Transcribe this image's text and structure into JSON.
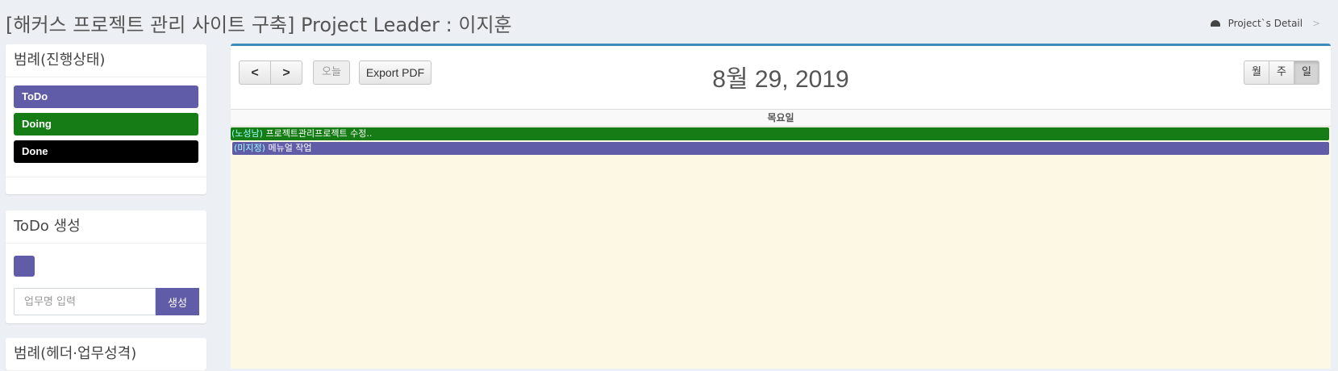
{
  "header": {
    "title": "[해커스 프로젝트 관리 사이트 구축] Project Leader : 이지훈",
    "breadcrumb": {
      "icon": "dashboard-icon",
      "label": "Project`s Detail",
      "separator": ">"
    }
  },
  "legend": {
    "title": "범례(진행상태)",
    "items": [
      {
        "label": "ToDo",
        "color": "#605ca8"
      },
      {
        "label": "Doing",
        "color": "#167d16"
      },
      {
        "label": "Done",
        "color": "#000000"
      }
    ]
  },
  "todo": {
    "title": "ToDo 생성",
    "swatch_color": "#605ca8",
    "input_placeholder": "업무명 입력",
    "create_label": "생성"
  },
  "legend2": {
    "title": "범례(헤더·업무성격)"
  },
  "calendar": {
    "prev_label": "<",
    "next_label": ">",
    "today_label": "오늘",
    "export_label": "Export PDF",
    "title": "8월 29, 2019",
    "views": {
      "month": "월",
      "week": "주",
      "day": "일"
    },
    "day_header": "목요일",
    "events": [
      {
        "who": "(노성남)",
        "text": " 프로젝트관리프로젝트 수정..",
        "color": "#167d16"
      },
      {
        "who": "(미지정)",
        "text": " 메뉴얼 작업",
        "color": "#605ca8"
      }
    ]
  },
  "colors": {
    "accent": "#3c8dbc",
    "todo": "#605ca8",
    "doing": "#167d16",
    "done": "#000000",
    "day_bg": "#fcf8e3"
  }
}
